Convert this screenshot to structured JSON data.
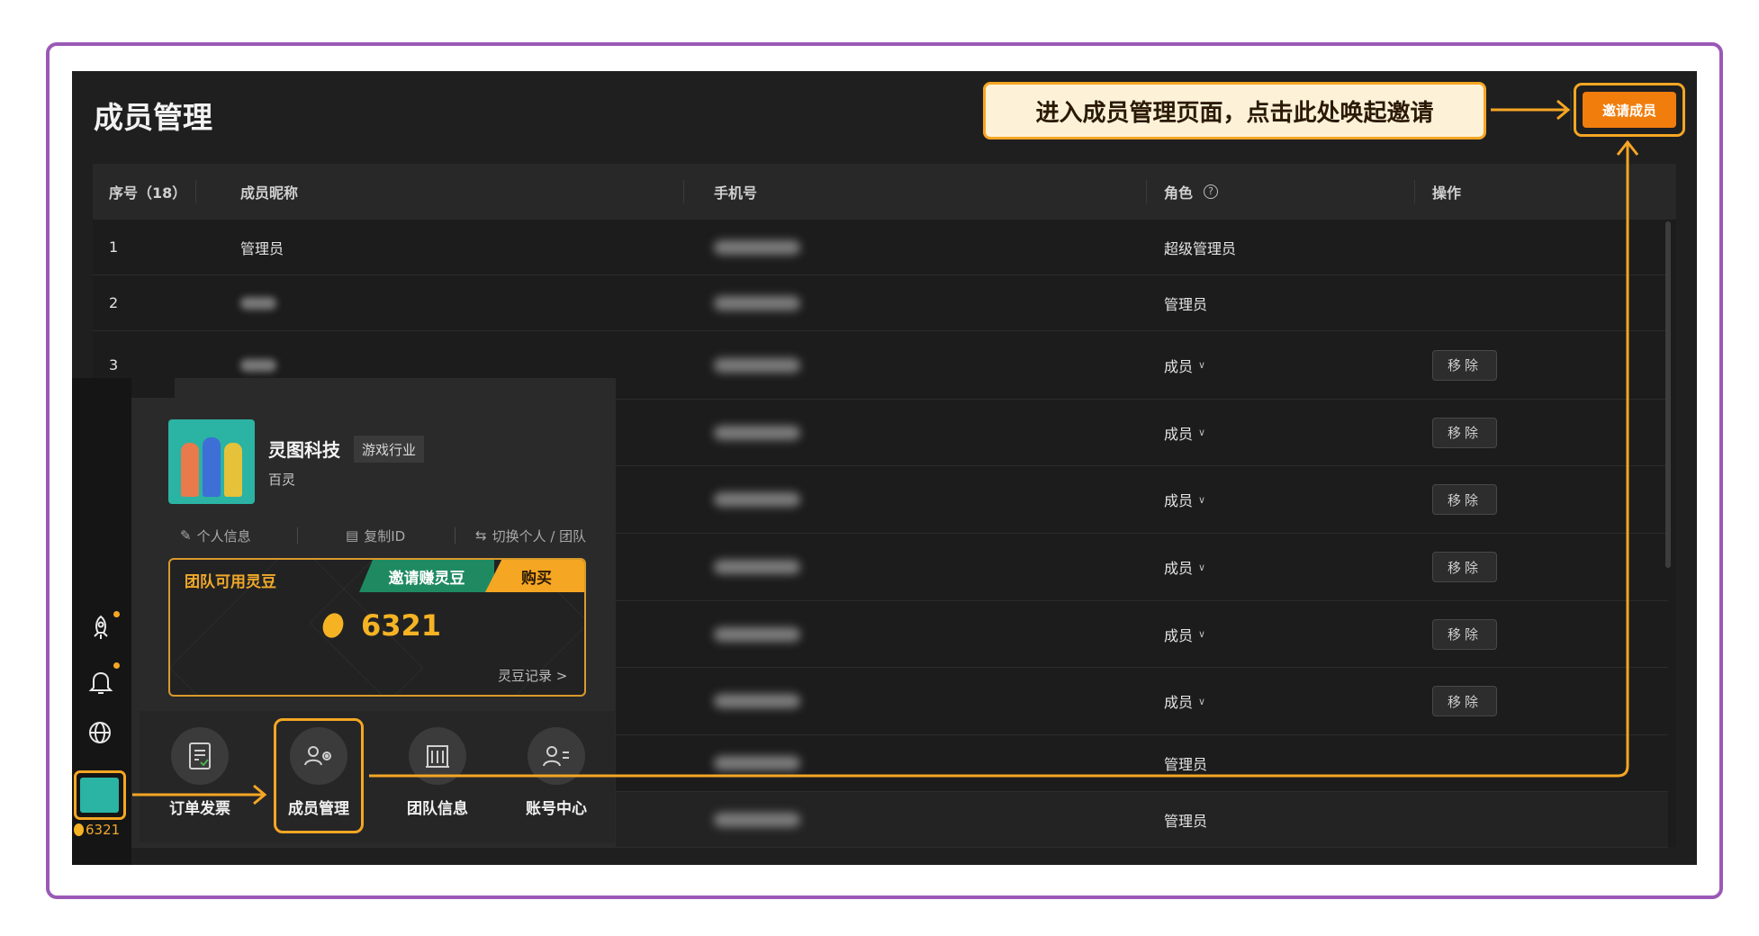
{
  "page": {
    "title": "成员管理"
  },
  "callout": {
    "text": "进入成员管理页面，点击此处唤起邀请"
  },
  "toolbar": {
    "invite_label": "邀请成员"
  },
  "table": {
    "headers": {
      "index": "序号（18）",
      "nickname": "成员昵称",
      "phone": "手机号",
      "role": "角色",
      "action": "操作"
    },
    "remove_label": "移除",
    "rows": [
      {
        "index": "1",
        "nickname": "管理员",
        "role": "超级管理员",
        "role_dropdown": false,
        "removable": false
      },
      {
        "index": "2",
        "nickname": "",
        "role": "管理员",
        "role_dropdown": false,
        "removable": false
      },
      {
        "index": "3",
        "nickname": "",
        "role": "成员",
        "role_dropdown": true,
        "removable": true
      },
      {
        "index": "",
        "nickname": "",
        "role": "成员",
        "role_dropdown": true,
        "removable": true
      },
      {
        "index": "",
        "nickname": "",
        "role": "成员",
        "role_dropdown": true,
        "removable": true
      },
      {
        "index": "",
        "nickname": "",
        "role": "成员",
        "role_dropdown": true,
        "removable": true
      },
      {
        "index": "",
        "nickname": "",
        "role": "成员",
        "role_dropdown": true,
        "removable": true
      },
      {
        "index": "",
        "nickname": "",
        "role": "成员",
        "role_dropdown": true,
        "removable": true
      },
      {
        "index": "",
        "nickname": "",
        "role": "管理员",
        "role_dropdown": false,
        "removable": false
      },
      {
        "index": "",
        "nickname": "",
        "role": "管理员",
        "role_dropdown": false,
        "removable": false
      }
    ]
  },
  "popup": {
    "company": "灵图科技",
    "industry": "游戏行业",
    "username": "百灵",
    "quick_links": [
      "个人信息",
      "复制ID",
      "切换个人 / 团队"
    ],
    "beans": {
      "label": "团队可用灵豆",
      "invite": "邀请赚灵豆",
      "buy": "购买",
      "amount": "6321",
      "log": "灵豆记录 >"
    },
    "menu": [
      "订单发票",
      "成员管理",
      "团队信息",
      "账号中心"
    ]
  },
  "rail": {
    "coins": "6321"
  },
  "colors": {
    "accent": "#f5a623",
    "invite_btn": "#f07d0c",
    "frame": "#9b59b6",
    "bean_invite": "#1f8a62"
  }
}
